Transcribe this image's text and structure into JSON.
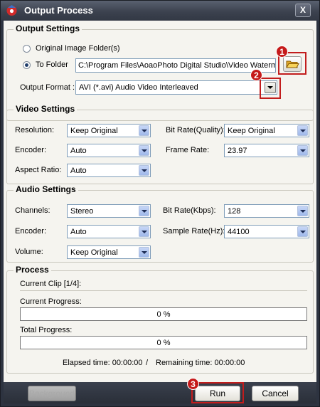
{
  "window": {
    "title": "Output Process",
    "close_glyph": "X"
  },
  "output_settings": {
    "legend": "Output Settings",
    "option_original": "Original Image Folder(s)",
    "option_to_folder": "To Folder",
    "selected_option": "To Folder",
    "folder_path": "C:\\Program Files\\AoaoPhoto Digital Studio\\Video Watermark",
    "format_label": "Output Format :",
    "format_value": "AVI  (*.avi) Audio Video Interleaved"
  },
  "video_settings": {
    "legend": "Video Settings",
    "resolution_label": "Resolution:",
    "resolution_value": "Keep Original",
    "bitrate_label": "Bit Rate(Quality):",
    "bitrate_value": "Keep Original",
    "encoder_label": "Encoder:",
    "encoder_value": "Auto",
    "framerate_label": "Frame Rate:",
    "framerate_value": "23.97",
    "aspect_label": "Aspect Ratio:",
    "aspect_value": "Auto"
  },
  "audio_settings": {
    "legend": "Audio Settings",
    "channels_label": "Channels:",
    "channels_value": "Stereo",
    "bitrate_label": "Bit Rate(Kbps):",
    "bitrate_value": "128",
    "encoder_label": "Encoder:",
    "encoder_value": "Auto",
    "samplerate_label": "Sample Rate(Hz):",
    "samplerate_value": "44100",
    "volume_label": "Volume:",
    "volume_value": "Keep Original"
  },
  "process": {
    "legend": "Process",
    "current_clip": "Current Clip [1/4]:",
    "current_progress_label": "Current Progress:",
    "current_progress_text": "0 %",
    "current_progress_fraction": 0,
    "total_progress_label": "Total Progress:",
    "total_progress_text": "0 %",
    "total_progress_fraction": 0,
    "elapsed": "Elapsed time: 00:00:00",
    "divider": "/",
    "remaining": "Remaining time: 00:00:00"
  },
  "buttons": {
    "background": "Background",
    "run": "Run",
    "cancel": "Cancel"
  },
  "badges": {
    "one": "1",
    "two": "2",
    "three": "3"
  },
  "icons": {
    "app": "app-logo-icon",
    "folder": "folder-open-icon"
  },
  "colors": {
    "highlight": "#c21d1d",
    "titlebar": "#3c424f",
    "client_bg": "#f5f4ef"
  }
}
